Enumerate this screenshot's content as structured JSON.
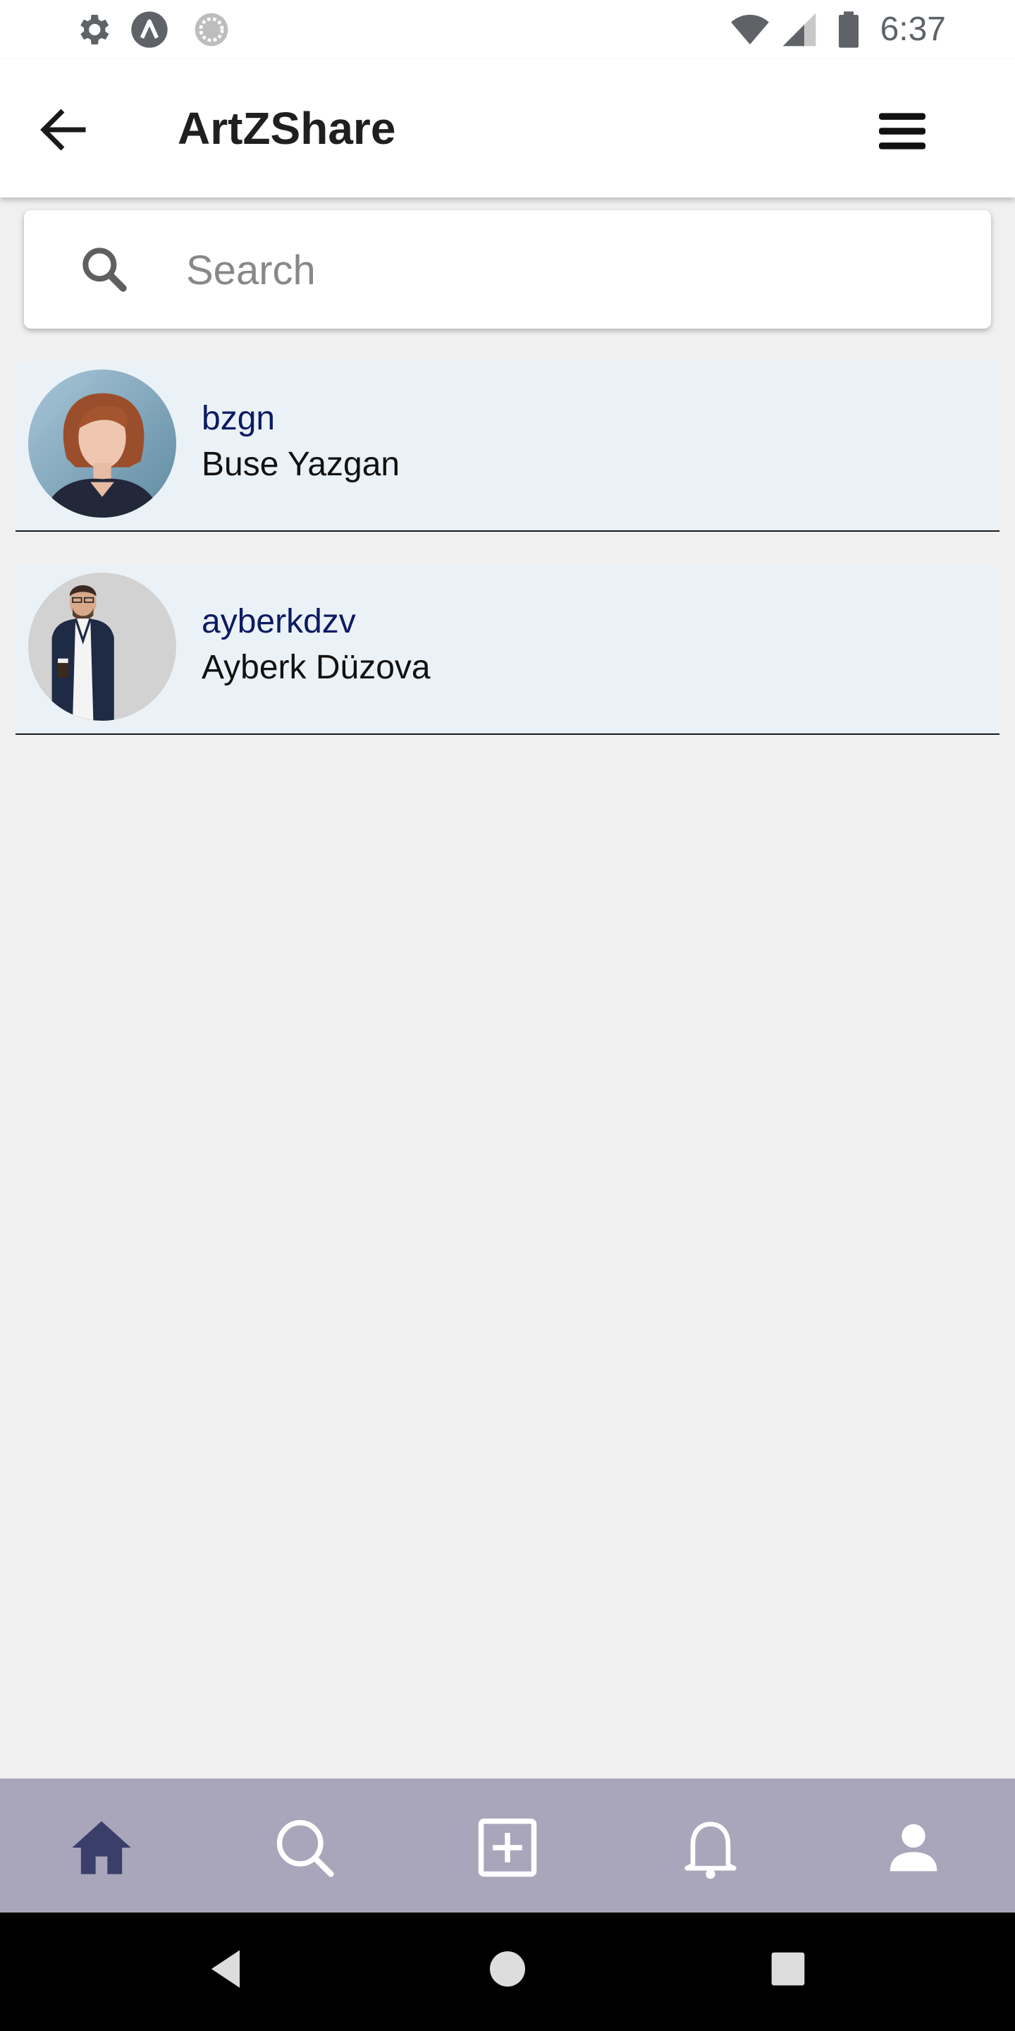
{
  "status_bar": {
    "time": "6:37",
    "left_icons": [
      "settings-icon",
      "a-circle-icon",
      "sync-icon"
    ],
    "right_icons": [
      "wifi-icon",
      "cellular-signal-icon",
      "battery-icon"
    ]
  },
  "app_bar": {
    "title": "ArtZShare",
    "back_icon": "arrow-left-icon",
    "menu_icon": "hamburger-menu-icon"
  },
  "search": {
    "placeholder": "Search",
    "value": "",
    "icon": "search-icon"
  },
  "users": [
    {
      "username": "bzgn",
      "full_name": "Buse Yazgan",
      "avatar": "avatar-woman-photo"
    },
    {
      "username": "ayberkdzv",
      "full_name": "Ayberk Düzova",
      "avatar": "avatar-man-photo"
    }
  ],
  "bottom_nav": {
    "items": [
      "home-icon",
      "search-icon",
      "add-post-icon",
      "notifications-bell-icon",
      "profile-icon"
    ],
    "active": "home-icon"
  },
  "system_nav": [
    "back-triangle-icon",
    "home-circle-icon",
    "recents-square-icon"
  ],
  "colors": {
    "row_background": "#ebf2f7",
    "username": "#0b1a63",
    "bottom_nav_background": "#a9a5bb",
    "active_nav_icon": "#3a3f6a",
    "page_background": "#f0f0f0"
  }
}
